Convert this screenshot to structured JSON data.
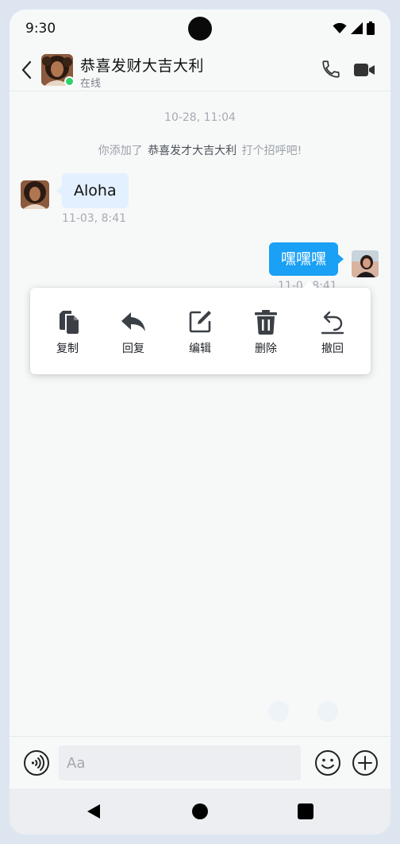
{
  "status_bar": {
    "time": "9:30"
  },
  "header": {
    "contact_name": "恭喜发财大吉大利",
    "contact_status": "在线",
    "back_icon": "chevron-left-icon",
    "call_icon": "phone-icon",
    "video_icon": "video-camera-icon"
  },
  "chat": {
    "date_divider": "10-28, 11:04",
    "system_message": {
      "prefix": "你添加了",
      "name": "恭喜发才大吉大利",
      "suffix": "打个招呼吧!"
    },
    "messages": [
      {
        "side": "left",
        "text": "Aloha",
        "time": "11-03, 8:41"
      },
      {
        "side": "right",
        "text": "嘿嘿嘿",
        "time": "11-0_ 8:41"
      }
    ]
  },
  "context_menu": {
    "items": [
      {
        "label": "复制",
        "icon": "copy-icon"
      },
      {
        "label": "回复",
        "icon": "reply-icon"
      },
      {
        "label": "编辑",
        "icon": "edit-icon"
      },
      {
        "label": "删除",
        "icon": "trash-icon"
      },
      {
        "label": "撤回",
        "icon": "undo-icon"
      }
    ]
  },
  "input_bar": {
    "placeholder": "Aa",
    "voice_icon": "voice-icon",
    "emoji_icon": "emoji-icon",
    "plus_icon": "plus-icon"
  },
  "colors": {
    "accent": "#1aa0f5",
    "received_bubble": "#e3f0ff",
    "online": "#2fd16a"
  }
}
